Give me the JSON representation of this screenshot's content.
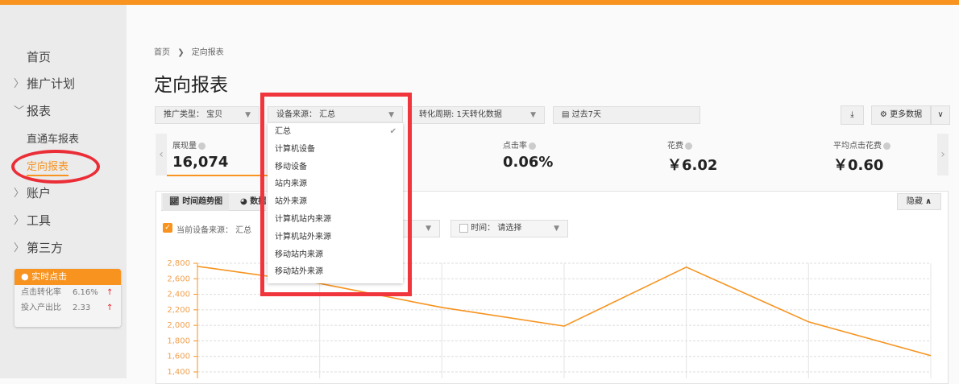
{
  "sidebar": {
    "items": [
      {
        "label": "首页"
      },
      {
        "label": "推广计划"
      },
      {
        "label": "报表"
      },
      {
        "label": "直通车报表"
      },
      {
        "label": "定向报表"
      },
      {
        "label": "账户"
      },
      {
        "label": "工具"
      },
      {
        "label": "第三方"
      }
    ],
    "realtime": {
      "title": "实时点击",
      "rows": [
        {
          "label": "点击转化率",
          "value": "6.16%"
        },
        {
          "label": "投入产出比",
          "value": "2.33"
        }
      ]
    }
  },
  "breadcrumb": {
    "home": "首页",
    "sep": "❯",
    "current": "定向报表"
  },
  "page_title": "定向报表",
  "filters": {
    "promo_type": "推广类型：  宝贝",
    "device": "设备来源：  汇总",
    "period": "转化周期:  1天转化数据",
    "date": "过去7天",
    "more": "更多数据"
  },
  "dropdown": {
    "options": [
      "汇总",
      "计算机设备",
      "移动设备",
      "站内来源",
      "站外来源",
      "计算机站内来源",
      "计算机站外来源",
      "移动站内来源",
      "移动站外来源"
    ],
    "selected": "汇总"
  },
  "metrics": [
    {
      "label": "展现量",
      "value": "16,074"
    },
    {
      "label": "点击率",
      "value": "0.06%"
    },
    {
      "label": "花费",
      "value": "￥6.02"
    },
    {
      "label": "平均点击花费",
      "value": "￥0.60"
    }
  ],
  "panel": {
    "tab_trend": "时间趋势图",
    "tab_data": "数据",
    "hide": "隐藏",
    "current_source": "当前设备来源：  汇总",
    "time_filter": "时间：  请选择"
  },
  "chart_data": {
    "type": "line",
    "ylim": [
      1400,
      2800
    ],
    "yticks": [
      "2,800",
      "2,600",
      "2,400",
      "2,200",
      "2,000",
      "1,800",
      "1,600",
      "1,400"
    ],
    "series": [
      {
        "name": "展现量",
        "values": [
          2760,
          2540,
          2230,
          1990,
          2750,
          2045,
          1610
        ]
      }
    ],
    "color": "#f7931e"
  }
}
